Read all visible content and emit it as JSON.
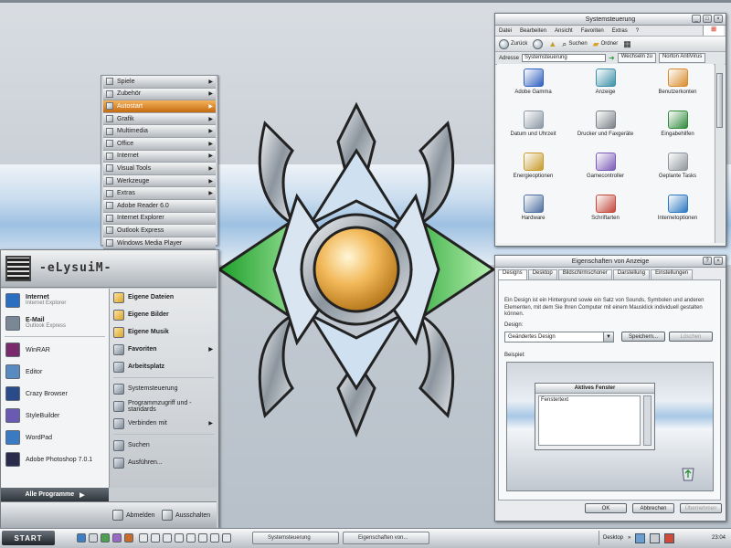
{
  "cascade_menu": {
    "items": [
      {
        "label": "Spiele",
        "arrow": true,
        "selected": false
      },
      {
        "label": "Zubehör",
        "arrow": true,
        "selected": false
      },
      {
        "label": "Autostart",
        "arrow": true,
        "selected": true
      },
      {
        "label": "Grafik",
        "arrow": true,
        "selected": false
      },
      {
        "label": "Multimedia",
        "arrow": true,
        "selected": false
      },
      {
        "label": "Office",
        "arrow": true,
        "selected": false
      },
      {
        "label": "Internet",
        "arrow": true,
        "selected": false
      },
      {
        "label": "Visual Tools",
        "arrow": true,
        "selected": false
      },
      {
        "label": "Werkzeuge",
        "arrow": true,
        "selected": false
      },
      {
        "label": "Extras",
        "arrow": true,
        "selected": false
      },
      {
        "label": "Adobe Reader 6.0",
        "arrow": false,
        "selected": false
      },
      {
        "label": "Internet Explorer",
        "arrow": false,
        "selected": false
      },
      {
        "label": "Outlook Express",
        "arrow": false,
        "selected": false
      },
      {
        "label": "Windows Media Player",
        "arrow": false,
        "selected": false
      }
    ]
  },
  "start_menu": {
    "user": "-eLysuiM-",
    "pinned": [
      {
        "title": "Internet",
        "subtitle": "Internet Explorer",
        "icon": "internet-icon"
      },
      {
        "title": "E-Mail",
        "subtitle": "Outlook Express",
        "icon": "email-icon"
      }
    ],
    "recent": [
      {
        "label": "WinRAR",
        "icon": "winrar-icon"
      },
      {
        "label": "Editor",
        "icon": "notepad-icon"
      },
      {
        "label": "Crazy Browser",
        "icon": "browser-icon"
      },
      {
        "label": "StyleBuilder",
        "icon": "stylebuilder-icon"
      },
      {
        "label": "WordPad",
        "icon": "wordpad-icon"
      },
      {
        "label": "Adobe Photoshop 7.0.1",
        "icon": "photoshop-icon"
      }
    ],
    "all_programs": "Alle Programme",
    "right_items": [
      {
        "label": "Eigene Dateien",
        "bold": true,
        "arrow": false,
        "icon": "folder-icon"
      },
      {
        "label": "Eigene Bilder",
        "bold": true,
        "arrow": false,
        "icon": "folder-icon"
      },
      {
        "label": "Eigene Musik",
        "bold": true,
        "arrow": false,
        "icon": "folder-icon"
      },
      {
        "label": "Favoriten",
        "bold": true,
        "arrow": true,
        "icon": "favorites-icon"
      },
      {
        "label": "Arbeitsplatz",
        "bold": true,
        "arrow": false,
        "icon": "computer-icon"
      },
      {
        "label": "Systemsteuerung",
        "bold": false,
        "arrow": false,
        "icon": "control-panel-icon"
      },
      {
        "label": "Programmzugriff und -standards",
        "bold": false,
        "arrow": false,
        "icon": "defaults-icon"
      },
      {
        "label": "Verbinden mit",
        "bold": false,
        "arrow": true,
        "icon": "network-icon"
      },
      {
        "label": "Suchen",
        "bold": false,
        "arrow": false,
        "icon": "search-icon"
      },
      {
        "label": "Ausführen...",
        "bold": false,
        "arrow": false,
        "icon": "run-icon"
      }
    ],
    "logoff": "Abmelden",
    "shutdown": "Ausschalten"
  },
  "control_panel": {
    "title": "Systemsteuerung",
    "menu": [
      "Datei",
      "Bearbeiten",
      "Ansicht",
      "Favoriten",
      "Extras",
      "?"
    ],
    "toolbar": {
      "back": "Zurück",
      "search": "Suchen",
      "folders": "Ordner"
    },
    "address_label": "Adresse",
    "address_value": "Systemsteuerung",
    "go": "Wechseln zu",
    "links": "Norton AntiVirus",
    "items": [
      {
        "label": "Adobe Gamma",
        "icon": "adobe-gamma-icon",
        "color": "#2f5fbf"
      },
      {
        "label": "Anzeige",
        "icon": "display-icon",
        "color": "#3c8fa8"
      },
      {
        "label": "Benutzerkonten",
        "icon": "user-accounts-icon",
        "color": "#d98b2a"
      },
      {
        "label": "Datum und Uhrzeit",
        "icon": "clock-icon",
        "color": "#8a96a3"
      },
      {
        "label": "Drucker und Faxgeräte",
        "icon": "printer-icon",
        "color": "#7a8088"
      },
      {
        "label": "Eingabehilfen",
        "icon": "accessibility-icon",
        "color": "#2f8a3a"
      },
      {
        "label": "Energieoptionen",
        "icon": "power-icon",
        "color": "#c79a2a"
      },
      {
        "label": "Gamecontroller",
        "icon": "gamepad-icon",
        "color": "#7b5bb7"
      },
      {
        "label": "Geplante Tasks",
        "icon": "tasks-icon",
        "color": "#8e959c"
      },
      {
        "label": "Hardware",
        "icon": "hardware-icon",
        "color": "#4d6fa0"
      },
      {
        "label": "Schriftarten",
        "icon": "fonts-icon",
        "color": "#c2473a"
      },
      {
        "label": "Internetoptionen",
        "icon": "internet-options-icon",
        "color": "#2a78c2"
      }
    ]
  },
  "display_props": {
    "title": "Eigenschaften von Anzeige",
    "tabs": [
      "Designs",
      "Desktop",
      "Bildschirmschoner",
      "Darstellung",
      "Einstellungen"
    ],
    "description": "Ein Design ist ein Hintergrund sowie ein Satz von Sounds, Symbolen und anderen Elementen, mit dem Sie Ihren Computer mit einem Mausklick individuell gestalten können.",
    "design_label": "Design:",
    "design_value": "Geändertes Design",
    "save_btn": "Speichern...",
    "delete_btn": "Löschen",
    "sample_label": "Beispiel:",
    "preview_window_title": "Aktives Fenster",
    "preview_window_text": "Fenstertext",
    "ok": "OK",
    "cancel": "Abbrechen",
    "apply": "Übernehmen"
  },
  "taskbar": {
    "start": "START",
    "tasks": [
      "Systemsteuerung",
      "Eigenschaften von..."
    ],
    "tray_label": "Desktop",
    "clock": "23:04"
  }
}
